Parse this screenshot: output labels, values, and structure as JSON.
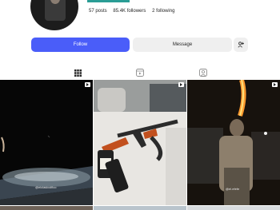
{
  "profile": {
    "stats": {
      "posts": "57 posts",
      "followers": "85.4K followers",
      "following": "2 following"
    }
  },
  "actions": {
    "follow_label": "Follow",
    "message_label": "Message",
    "suggest_icon": "add-person-icon"
  },
  "tabs": [
    {
      "icon": "grid-icon",
      "active": true
    },
    {
      "icon": "reels-icon",
      "active": false
    },
    {
      "icon": "tagged-icon",
      "active": false
    }
  ],
  "grid": [
    {
      "type": "reel",
      "caption": "@elclasicolfico"
    },
    {
      "type": "reel",
      "caption": ""
    },
    {
      "type": "reel",
      "caption": "@el.efefe"
    }
  ],
  "colors": {
    "accent": "#4a5df9",
    "teal": "#2a9d95",
    "button_gray": "#efefef"
  }
}
